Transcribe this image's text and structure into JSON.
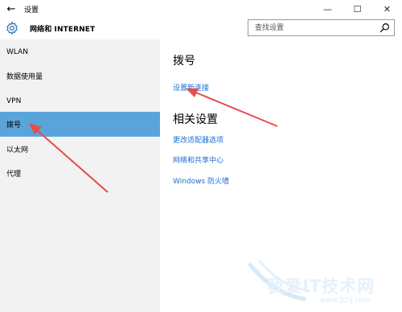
{
  "titlebar": {
    "title": "设置",
    "back_glyph": "←",
    "minimize_glyph": "—",
    "maximize_glyph": "☐",
    "close_glyph": "✕"
  },
  "header": {
    "title": "网络和 INTERNET",
    "search_placeholder": "查找设置"
  },
  "sidebar": {
    "items": [
      {
        "label": "WLAN",
        "active": false
      },
      {
        "label": "数据使用量",
        "active": false
      },
      {
        "label": "VPN",
        "active": false
      },
      {
        "label": "拨号",
        "active": true
      },
      {
        "label": "以太网",
        "active": false
      },
      {
        "label": "代理",
        "active": false
      }
    ]
  },
  "main": {
    "section_title": "拨号",
    "setup_link": "设置新连接",
    "related_title": "相关设置",
    "related_links": [
      "更改适配器选项",
      "网络和共享中心",
      "Windows 防火墙"
    ]
  },
  "watermark": {
    "text": "我爱IT技术网",
    "url": "www.52ij.com"
  },
  "colors": {
    "accent": "#5aa4dc",
    "link": "#1a6fd1",
    "sidebar_bg": "#f2f2f2",
    "arrow": "#e84c4c"
  },
  "icons": {
    "header": "gear-icon",
    "search": "search-icon"
  }
}
